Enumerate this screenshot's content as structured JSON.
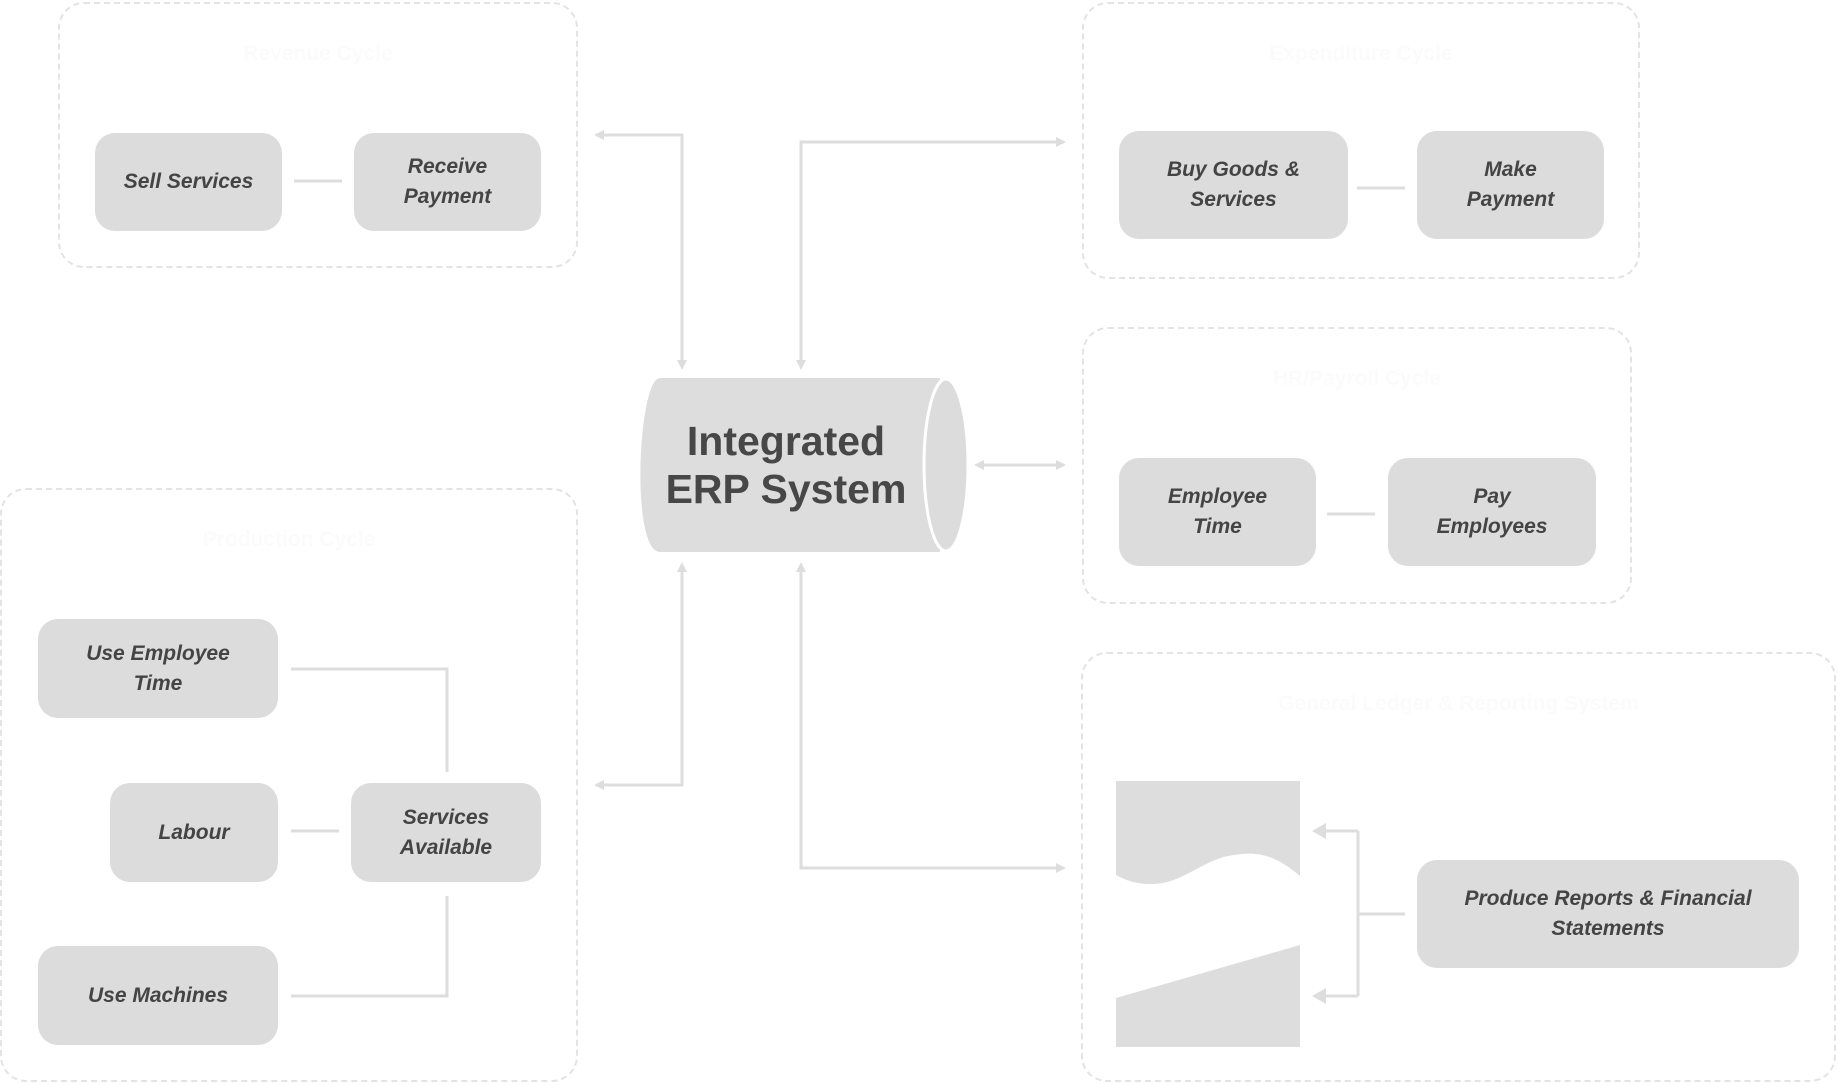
{
  "groups": {
    "revenue": {
      "title": "Revenue Cycle",
      "nodes": [
        "Sell Services",
        "Receive Payment"
      ]
    },
    "expenditure": {
      "title": "Expenditure Cycle",
      "nodes": [
        "Buy Goods & Services",
        "Make Payment"
      ]
    },
    "payroll": {
      "title": "HR/Payroll Cycle",
      "nodes": [
        "Employee Time",
        "Pay Employees"
      ]
    },
    "production": {
      "title": "Production Cycle",
      "nodes": [
        "Use Employee Time",
        "Labour",
        "Services Available",
        "Use Machines"
      ]
    },
    "reporting": {
      "title": "General Ledger & Reporting System",
      "nodes": [
        "Produce Reports & Financial Statements"
      ]
    }
  },
  "center": {
    "label_line1": "Integrated",
    "label_line2": "ERP System"
  },
  "colors": {
    "node_fill": "#dcdcdc",
    "text": "#444444",
    "connector": "#dddddd",
    "group_border": "#e3e3e3"
  }
}
